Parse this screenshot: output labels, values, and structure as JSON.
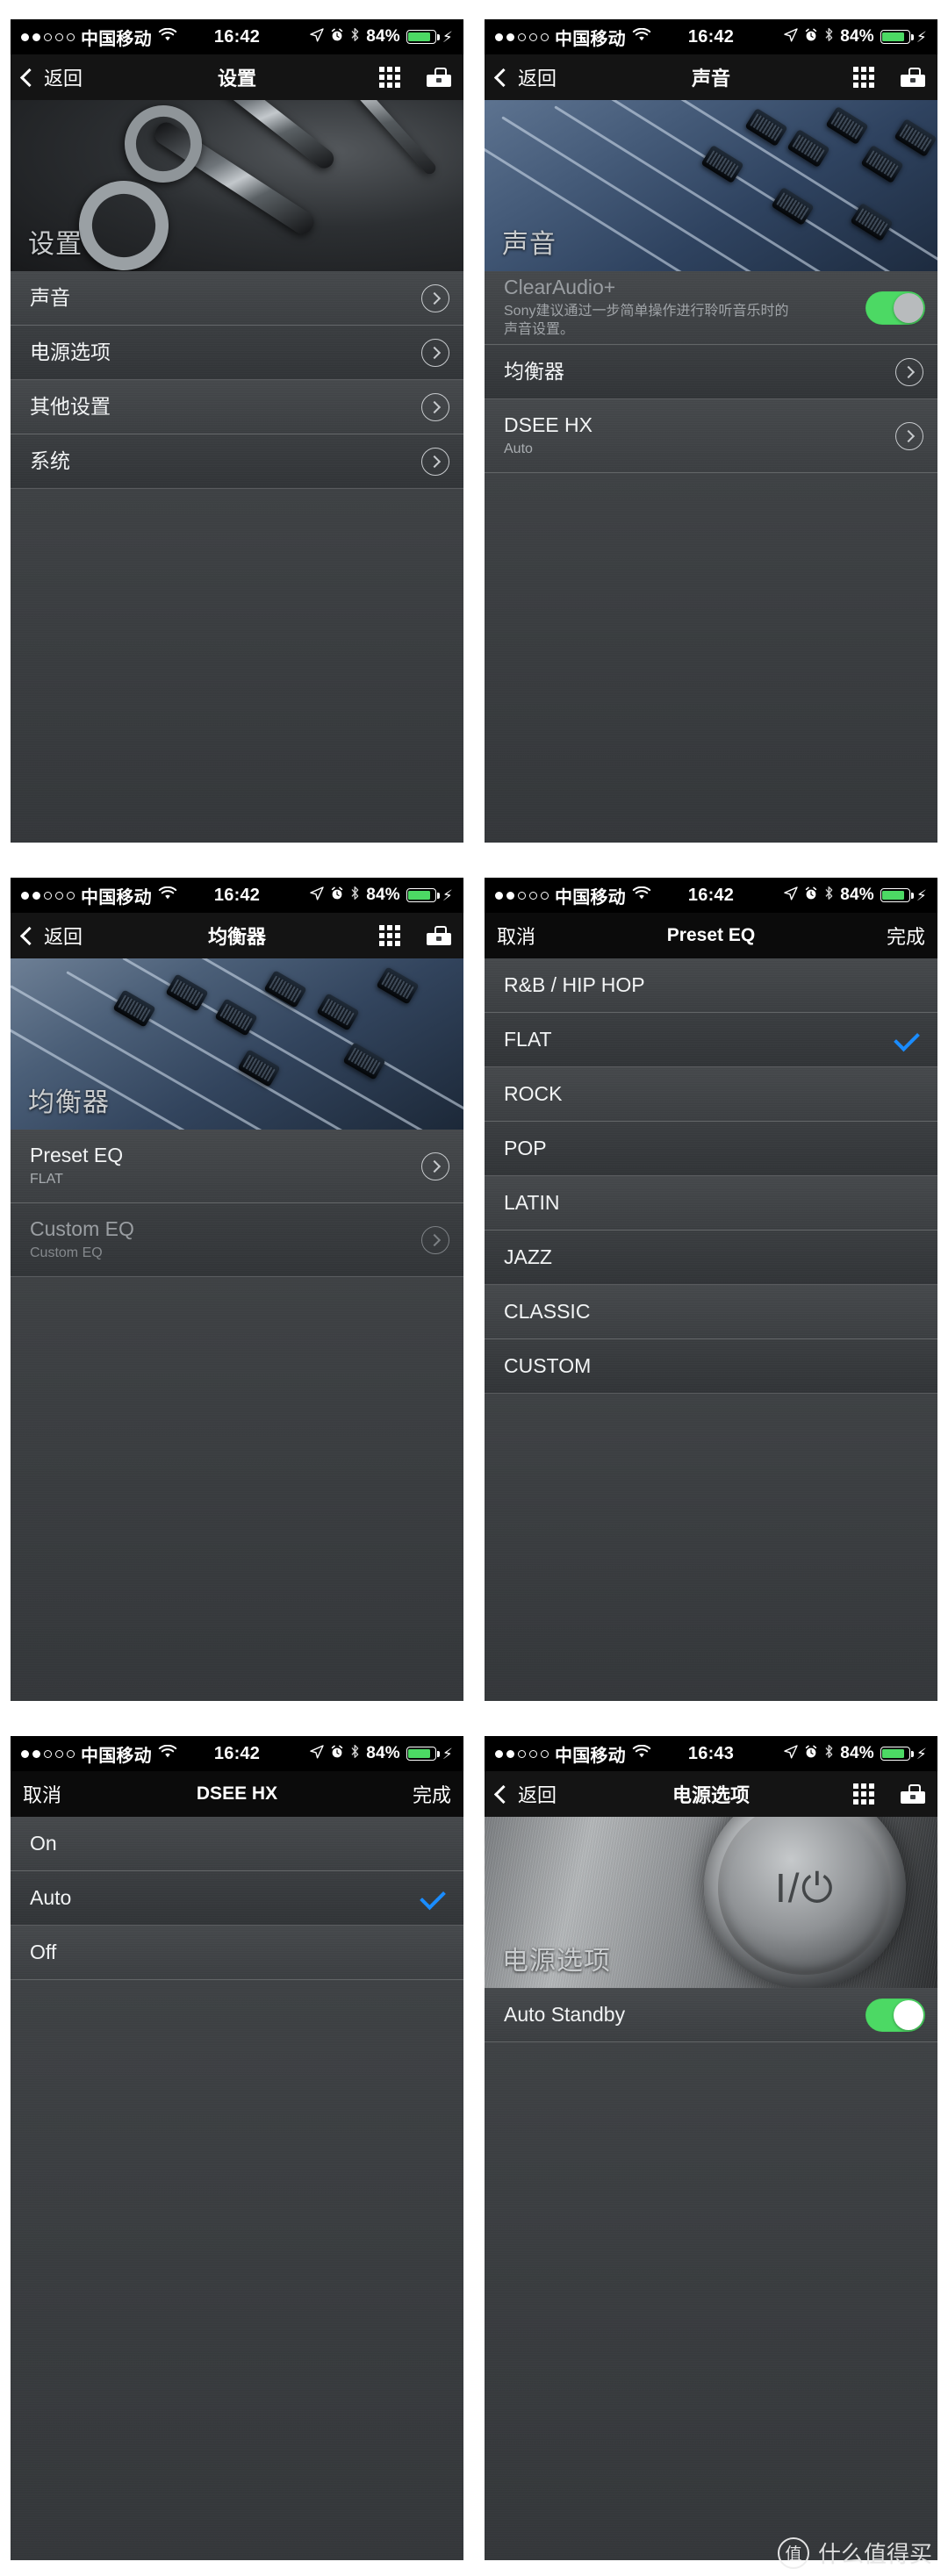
{
  "status_bar": {
    "carrier": "中国移动",
    "signal_dots_filled": 2,
    "signal_dots_total": 5,
    "wifi_icon": "wifi-icon",
    "time_1642": "16:42",
    "time_1643": "16:43",
    "location_icon": "location-arrow-icon",
    "alarm_icon": "alarm-clock-icon",
    "bluetooth_icon": "bluetooth-icon",
    "battery_percent": "84%",
    "battery_level": 84,
    "charging_icon": "lightning-bolt-icon"
  },
  "icons": {
    "grid": "grid-icon",
    "toolbox": "toolbox-icon",
    "back_chevron": "chevron-left-icon",
    "row_chevron": "chevron-right-circle-icon",
    "check": "checkmark-icon"
  },
  "colors": {
    "accent_blue": "#1a8cff",
    "toggle_green": "#4cd964",
    "list_bg": "#3e4144",
    "navbar_bg": "#141414",
    "text_primary": "#f2f4f5",
    "text_secondary": "#a8acb0"
  },
  "panels": [
    {
      "id": "settings",
      "nav": {
        "back_label": "返回",
        "title": "设置",
        "has_grid": true,
        "has_toolbox": true
      },
      "hero": {
        "label": "设置",
        "art": "wrenches-photo"
      },
      "time": "16:42",
      "rows": [
        {
          "title": "声音",
          "accessory": "chevron"
        },
        {
          "title": "电源选项",
          "accessory": "chevron"
        },
        {
          "title": "其他设置",
          "accessory": "chevron"
        },
        {
          "title": "系统",
          "accessory": "chevron"
        }
      ]
    },
    {
      "id": "sound",
      "nav": {
        "back_label": "返回",
        "title": "声音",
        "has_grid": true,
        "has_toolbox": true
      },
      "hero": {
        "label": "声音",
        "art": "mixer-faders-photo"
      },
      "time": "16:42",
      "rows": [
        {
          "title": "ClearAudio+",
          "desc": "Sony建议通过一步简单操作进行聆听音乐时的声音设置。",
          "accessory": "toggle",
          "toggle_on": true,
          "dim": true
        },
        {
          "title": "均衡器",
          "accessory": "chevron"
        },
        {
          "title": "DSEE HX",
          "sub": "Auto",
          "accessory": "chevron"
        }
      ]
    },
    {
      "id": "equalizer",
      "nav": {
        "back_label": "返回",
        "title": "均衡器",
        "has_grid": true,
        "has_toolbox": true
      },
      "hero": {
        "label": "均衡器",
        "art": "mixer-faders-photo"
      },
      "time": "16:42",
      "rows": [
        {
          "title": "Preset EQ",
          "sub": "FLAT",
          "accessory": "chevron"
        },
        {
          "title": "Custom EQ",
          "sub": "Custom EQ",
          "accessory": "chevron",
          "dim": true
        }
      ]
    },
    {
      "id": "preset-eq",
      "nav": {
        "cancel_label": "取消",
        "title": "Preset EQ",
        "done_label": "完成"
      },
      "time": "16:42",
      "rows": [
        {
          "title": "R&B / HIP HOP",
          "selected": false
        },
        {
          "title": "FLAT",
          "selected": true
        },
        {
          "title": "ROCK",
          "selected": false
        },
        {
          "title": "POP",
          "selected": false
        },
        {
          "title": "LATIN",
          "selected": false
        },
        {
          "title": "JAZZ",
          "selected": false
        },
        {
          "title": "CLASSIC",
          "selected": false
        },
        {
          "title": "CUSTOM",
          "selected": false
        }
      ]
    },
    {
      "id": "dsee-hx",
      "nav": {
        "cancel_label": "取消",
        "title": "DSEE HX",
        "done_label": "完成"
      },
      "time": "16:42",
      "rows": [
        {
          "title": "On",
          "selected": false
        },
        {
          "title": "Auto",
          "selected": true
        },
        {
          "title": "Off",
          "selected": false
        }
      ]
    },
    {
      "id": "power-options",
      "nav": {
        "back_label": "返回",
        "title": "电源选项",
        "has_grid": true,
        "has_toolbox": true
      },
      "hero": {
        "label": "电源选项",
        "art": "power-button-photo"
      },
      "time": "16:43",
      "rows": [
        {
          "title": "Auto Standby",
          "accessory": "toggle",
          "toggle_on": true
        }
      ]
    }
  ],
  "watermark": {
    "logo_char": "值",
    "text": "什么值得买"
  }
}
